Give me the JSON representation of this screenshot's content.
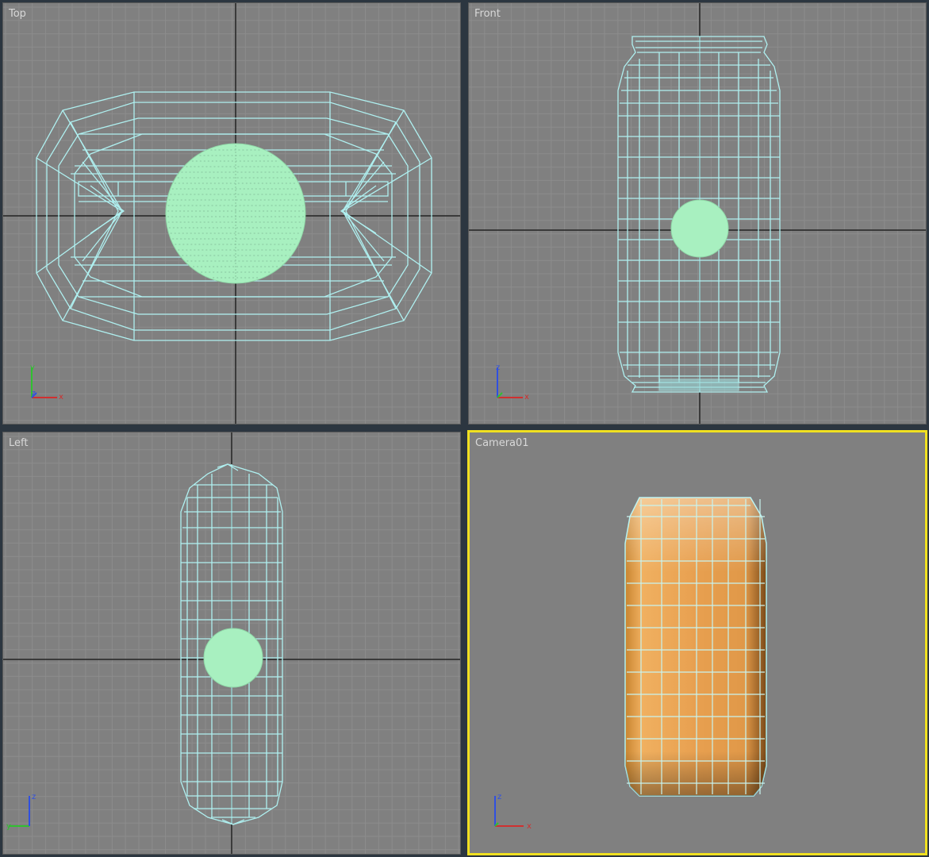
{
  "viewports": {
    "top": {
      "label": "Top",
      "active": false
    },
    "front": {
      "label": "Front",
      "active": false
    },
    "left": {
      "label": "Left",
      "active": false
    },
    "camera": {
      "label": "Camera01",
      "active": true
    }
  },
  "axis_gizmo": {
    "x": "x",
    "y": "y",
    "z": "z"
  },
  "colors": {
    "viewport_bg": "#808080",
    "grid": "#8c8c8c",
    "home_grid": "#222222",
    "wireframe": "#aff0f0",
    "gizmo_sphere": "#a8f0c0",
    "active_border": "#f0e020",
    "shaded_can": "#e0a050",
    "axis_x": "#d03030",
    "axis_y": "#30c030",
    "axis_z": "#3050e0"
  },
  "icons": [
    "axis-tripod-icon"
  ]
}
